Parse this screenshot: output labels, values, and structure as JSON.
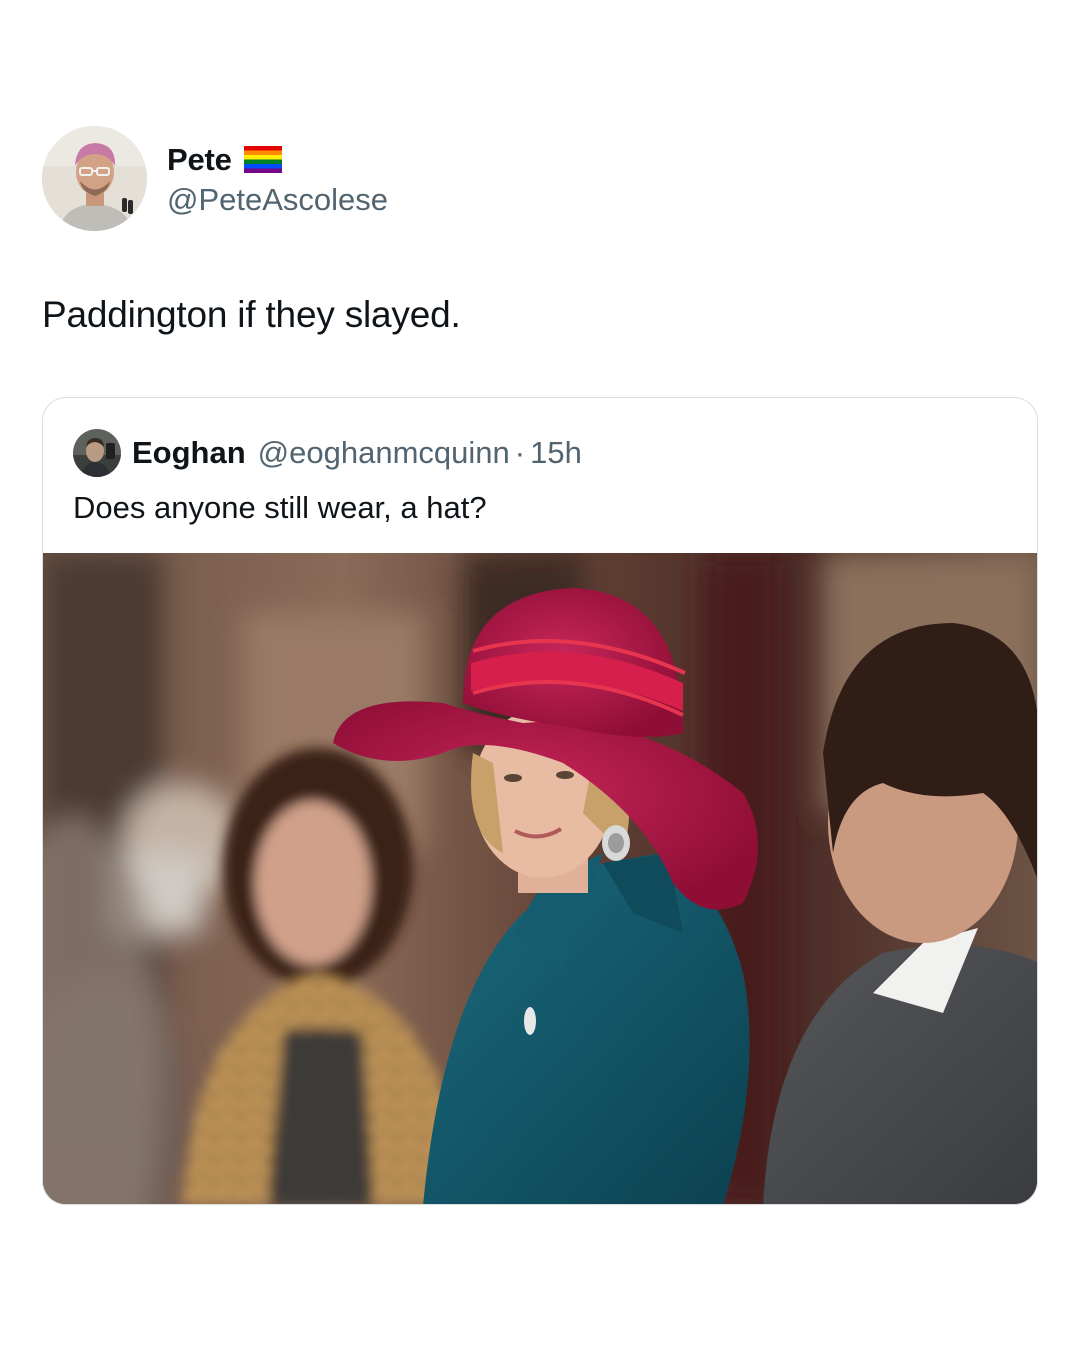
{
  "author": {
    "display_name": "Pete",
    "badge_icon": "rainbow-flag-icon",
    "handle": "@PeteAscolese"
  },
  "tweet": {
    "text": "Paddington if they slayed."
  },
  "quoted_tweet": {
    "display_name": "Eoghan",
    "handle": "@eoghanmcquinn",
    "separator": "·",
    "time": "15h",
    "text": "Does anyone still wear, a hat?",
    "media": "photo"
  },
  "colors": {
    "text_primary": "#0f1419",
    "text_secondary": "#536471",
    "card_border": "#d8dde1",
    "hat": "#b8184a",
    "coat": "#125466"
  }
}
